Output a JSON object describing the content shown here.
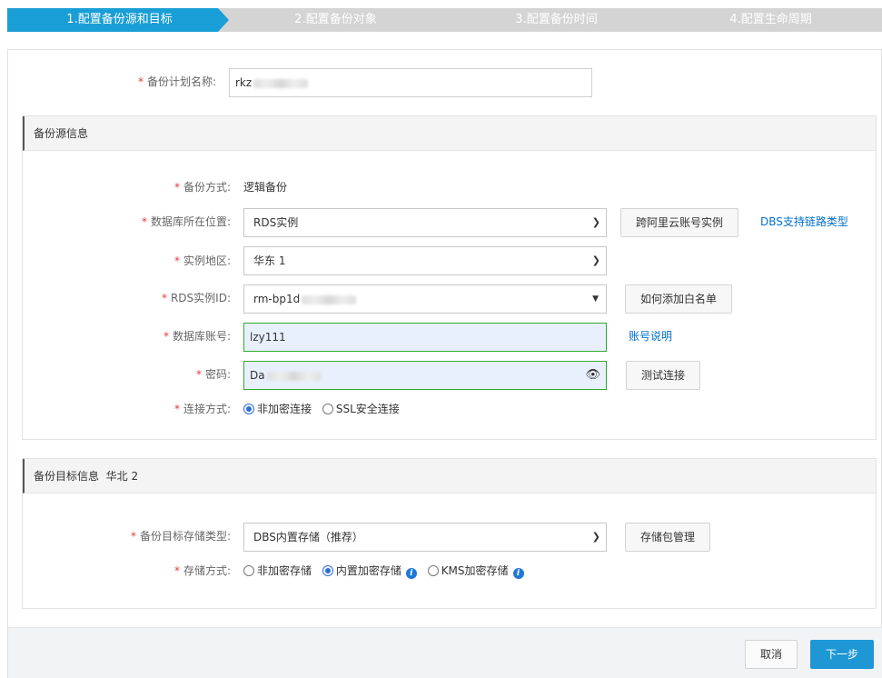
{
  "steps": [
    {
      "label": "1.配置备份源和目标",
      "active": true
    },
    {
      "label": "2.配置备份对象",
      "active": false
    },
    {
      "label": "3.配置备份时间",
      "active": false
    },
    {
      "label": "4.配置生命周期",
      "active": false
    }
  ],
  "plan_name": {
    "label": "备份计划名称:",
    "value": "rkz"
  },
  "source": {
    "title": "备份源信息",
    "backup_method": {
      "label": "备份方式:",
      "value": "逻辑备份"
    },
    "db_location": {
      "label": "数据库所在位置:",
      "value": "RDS实例",
      "cross_account_button": "跨阿里云账号实例",
      "link_types_link": "DBS支持链路类型"
    },
    "region": {
      "label": "实例地区:",
      "value": "华东 1"
    },
    "rds_id": {
      "label": "RDS实例ID:",
      "value": "rm-bp1d",
      "whitelist_button": "如何添加白名单"
    },
    "db_account": {
      "label": "数据库账号:",
      "value": "lzy111",
      "help_link": "账号说明"
    },
    "password": {
      "label": "密码:",
      "value": "Da",
      "test_button": "测试连接"
    },
    "connection": {
      "label": "连接方式:",
      "options": [
        "非加密连接",
        "SSL安全连接"
      ],
      "selected": "非加密连接"
    }
  },
  "target": {
    "title": "备份目标信息",
    "region": "华北 2",
    "storage_type": {
      "label": "备份目标存储类型:",
      "value": "DBS内置存储（推荐）",
      "manage_button": "存储包管理"
    },
    "storage_method": {
      "label": "存储方式:",
      "options": [
        "非加密存储",
        "内置加密存储",
        "KMS加密存储"
      ],
      "selected": "内置加密存储"
    }
  },
  "footer": {
    "cancel": "取消",
    "next": "下一步"
  },
  "colors": {
    "active_step": "#1a9ed6",
    "inactive_step": "#d4d4d4",
    "primary": "#1e97d4",
    "link": "#0070cc",
    "required": "#e4393c"
  },
  "icons": {
    "select": "chevron-down-icon",
    "password": "eye-icon",
    "help": "info-icon"
  }
}
